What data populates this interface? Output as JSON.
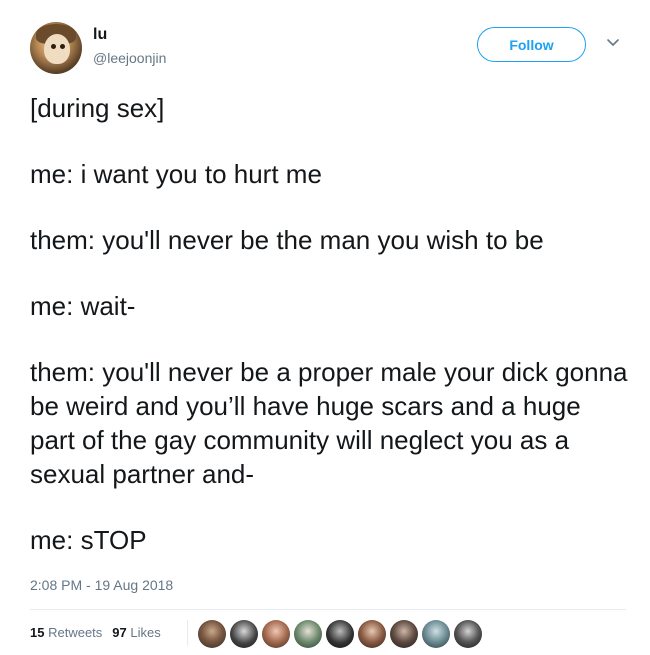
{
  "author": {
    "name": "lu",
    "handle": "@leejoonjin"
  },
  "follow_button": {
    "label": "Follow"
  },
  "tweet": {
    "paragraphs": [
      "[during sex]",
      "me: i want you to hurt me",
      "them: you'll never be the man you wish to be",
      "me: wait-",
      "them: you'll never be a proper male your dick gonna be weird and you’ll have huge scars and a huge part of the gay community will neglect you as a sexual partner and-",
      "me: sTOP"
    ],
    "timestamp": "2:08 PM - 19 Aug 2018"
  },
  "stats": {
    "retweets_count": "15",
    "retweets_label": "Retweets",
    "likes_count": "97",
    "likes_label": "Likes"
  },
  "colors": {
    "accent": "#1da1f2",
    "text": "#14171a",
    "muted": "#657786"
  },
  "icons": {
    "caret": "chevron-down-icon"
  }
}
